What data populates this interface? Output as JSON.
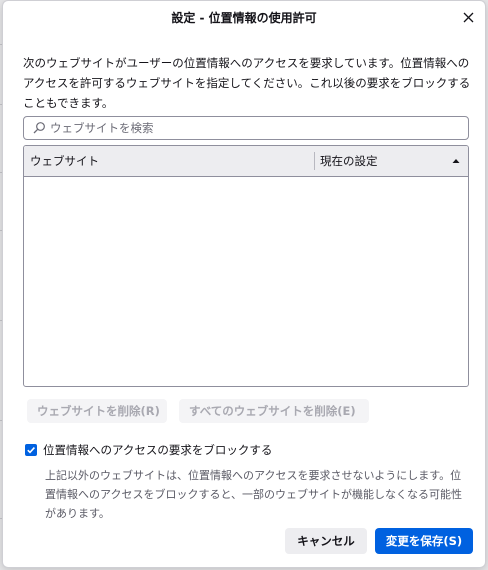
{
  "dialog": {
    "title": "設定 - 位置情報の使用許可",
    "close_icon": "close-icon"
  },
  "description": "次のウェブサイトがユーザーの位置情報へのアクセスを要求しています。位置情報へのアクセスを許可するウェブサイトを指定してください。これ以後の要求をブロックすることもできます。",
  "search": {
    "placeholder": "ウェブサイトを検索",
    "value": "",
    "icon": "search-icon"
  },
  "table": {
    "columns": [
      {
        "label": "ウェブサイト"
      },
      {
        "label": "現在の設定",
        "sort": "ascending"
      }
    ],
    "rows": []
  },
  "actions": {
    "remove_site_label": "ウェブサイトを削除(R)",
    "remove_all_label": "すべてのウェブサイトを削除(E)"
  },
  "block": {
    "checked": true,
    "label": "位置情報へのアクセスの要求をブロックする",
    "description": "上記以外のウェブサイトは、位置情報へのアクセスを要求させないようにします。位置情報へのアクセスをブロックすると、一部のウェブサイトが機能しなくなる可能性があります。"
  },
  "footer": {
    "cancel_label": "キャンセル",
    "save_label": "変更を保存(S)"
  },
  "colors": {
    "accent": "#0061e0",
    "disabled_bg": "#f4f4f6",
    "header_bg": "#ededf0"
  }
}
